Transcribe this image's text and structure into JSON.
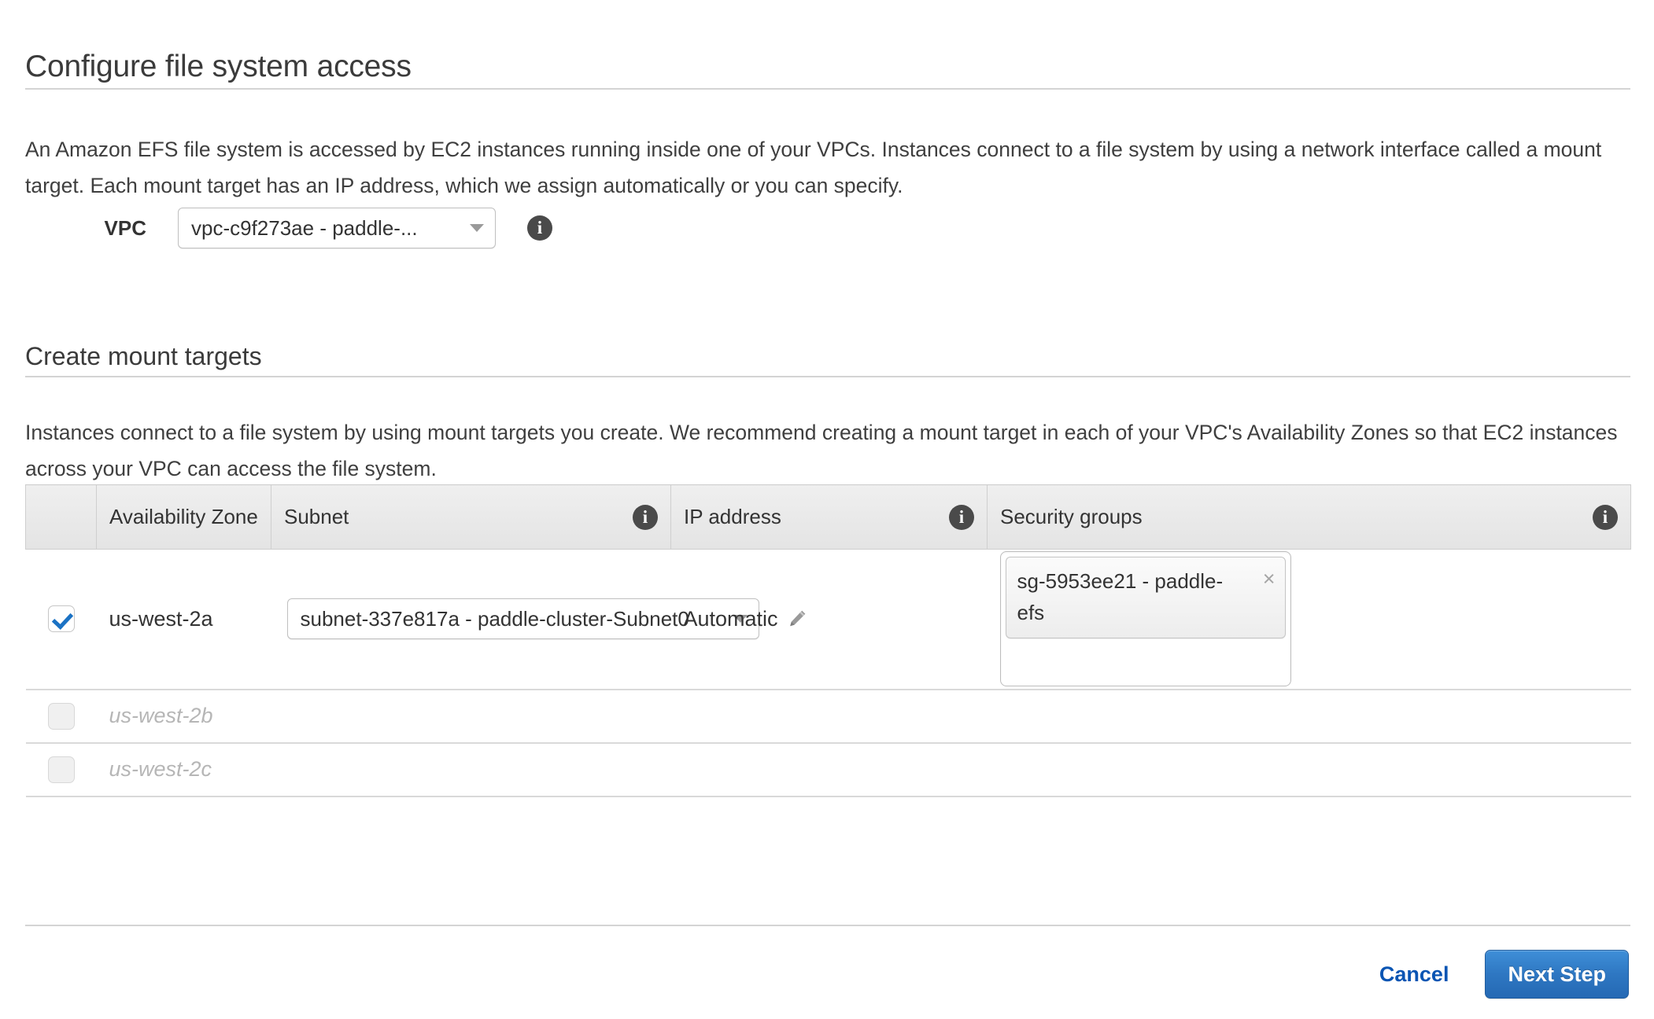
{
  "page": {
    "title": "Configure file system access",
    "intro": "An Amazon EFS file system is accessed by EC2 instances running inside one of your VPCs. Instances connect to a file system by using a network interface called a mount target. Each mount target has an IP address, which we assign automatically or you can specify."
  },
  "vpc": {
    "label": "VPC",
    "selected": "vpc-c9f273ae - paddle-...",
    "info_icon": "info-icon"
  },
  "mount_targets": {
    "section_title": "Create mount targets",
    "intro": "Instances connect to a file system by using mount targets you create. We recommend creating a mount target in each of your VPC's Availability Zones so that EC2 instances across your VPC can access the file system.",
    "columns": {
      "availability_zone": "Availability Zone",
      "subnet": "Subnet",
      "ip_address": "IP address",
      "security_groups": "Security groups"
    },
    "rows": [
      {
        "selected": true,
        "availability_zone": "us-west-2a",
        "subnet": "subnet-337e817a - paddle-cluster-Subnet0",
        "ip_address": "Automatic",
        "ip_edit_icon": "pencil-icon",
        "security_group_token": "sg-5953ee21 - paddle-efs",
        "token_remove": "×"
      },
      {
        "selected": false,
        "availability_zone": "us-west-2b",
        "subnet": "",
        "ip_address": "",
        "security_group_token": ""
      },
      {
        "selected": false,
        "availability_zone": "us-west-2c",
        "subnet": "",
        "ip_address": "",
        "security_group_token": ""
      }
    ]
  },
  "footer": {
    "cancel_label": "Cancel",
    "next_label": "Next Step"
  },
  "colors": {
    "accent_blue": "#2569b4",
    "link_blue": "#0a55b3",
    "check_blue": "#1b72c4",
    "header_bg": "#e8e8e8",
    "divider": "#d4d4d4",
    "disabled_text": "#b6b6b6"
  }
}
